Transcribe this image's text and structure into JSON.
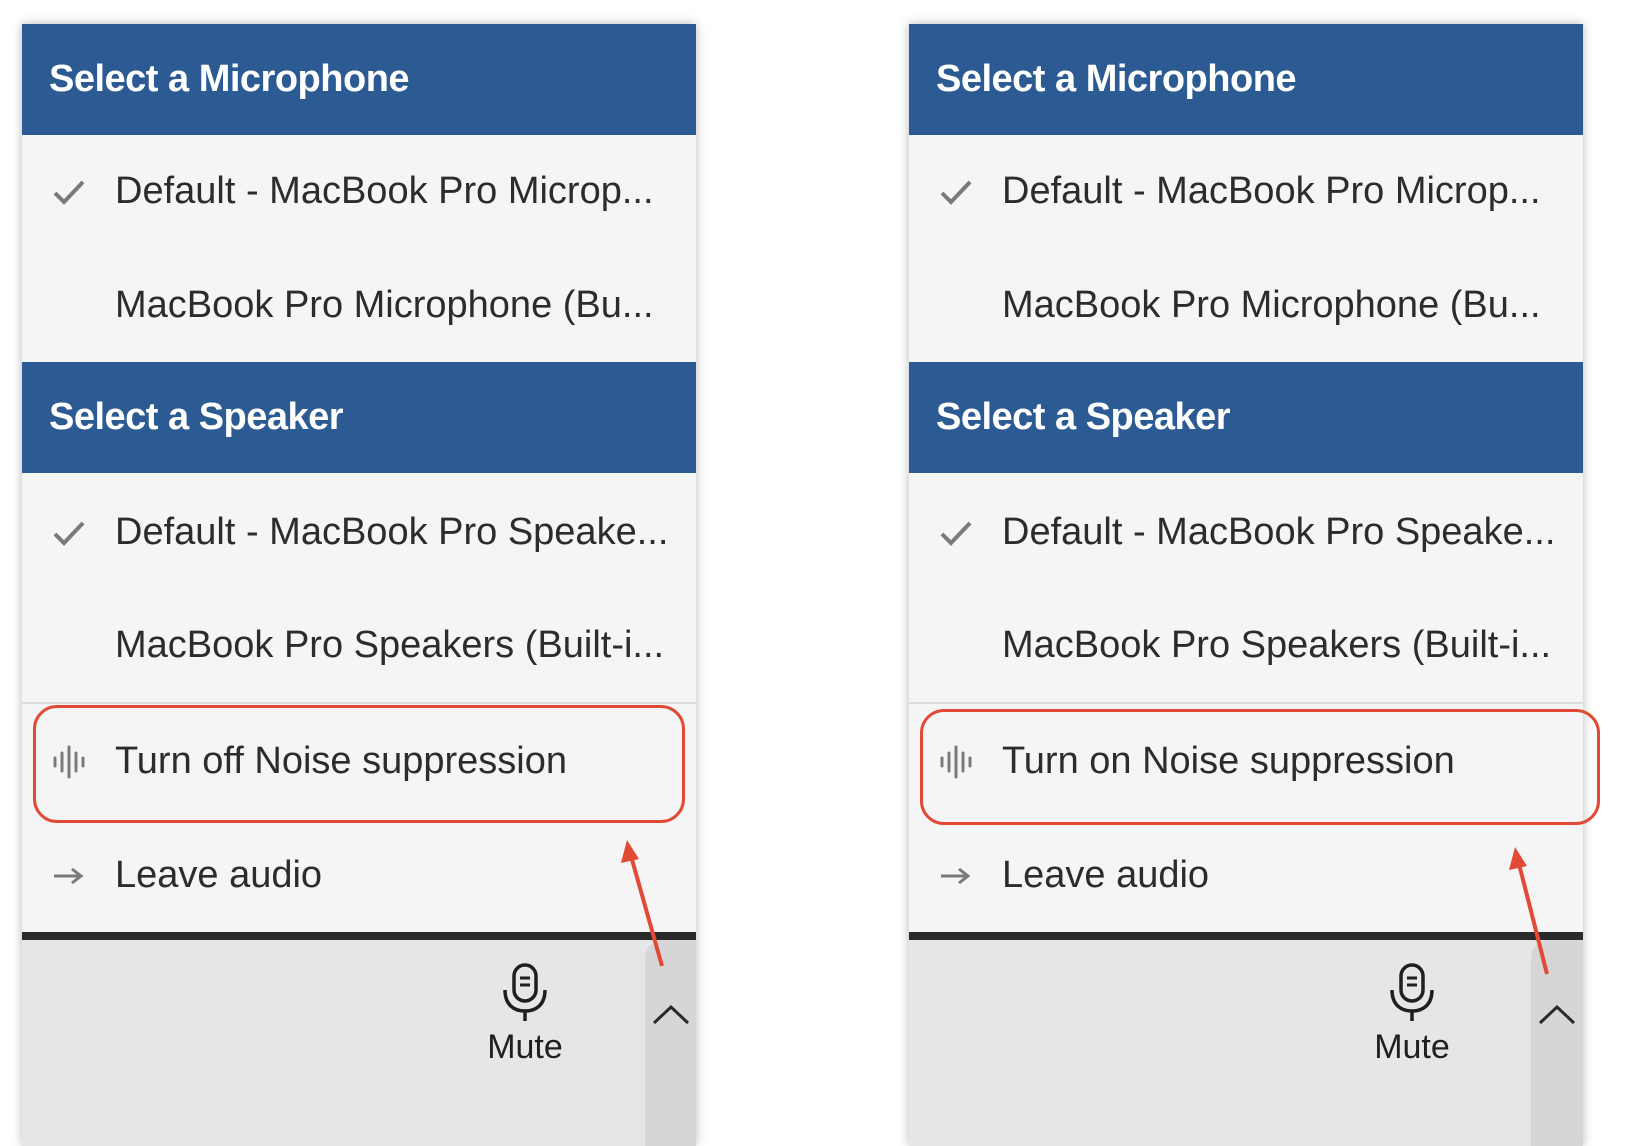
{
  "panels": [
    {
      "mic_header": "Select a Microphone",
      "mic_items": [
        "Default - MacBook Pro Microp...",
        "MacBook Pro Microphone (Bu..."
      ],
      "speaker_header": "Select a Speaker",
      "speaker_items": [
        "Default - MacBook Pro Speake...",
        "MacBook Pro Speakers (Built-i..."
      ],
      "noise_label": "Turn off Noise suppression",
      "leave_label": "Leave audio",
      "mute_label": "Mute"
    },
    {
      "mic_header": "Select a Microphone",
      "mic_items": [
        "Default - MacBook Pro Microp...",
        "MacBook Pro Microphone (Bu..."
      ],
      "speaker_header": "Select a Speaker",
      "speaker_items": [
        "Default - MacBook Pro Speake...",
        "MacBook Pro Speakers (Built-i..."
      ],
      "noise_label": "Turn on Noise suppression",
      "leave_label": "Leave audio",
      "mute_label": "Mute"
    }
  ],
  "icons": {
    "selected": "checkmark-icon",
    "noise": "noise-suppression-icon",
    "leave": "arrow-right-icon",
    "mute": "microphone-icon",
    "expand": "chevron-up-icon",
    "callout": "red-arrow-icon"
  },
  "colors": {
    "header_bg": "#2c5b94",
    "menu_bg": "#f5f5f5",
    "highlight": "#e34a36",
    "toolbar_bg": "#e6e6e8"
  }
}
